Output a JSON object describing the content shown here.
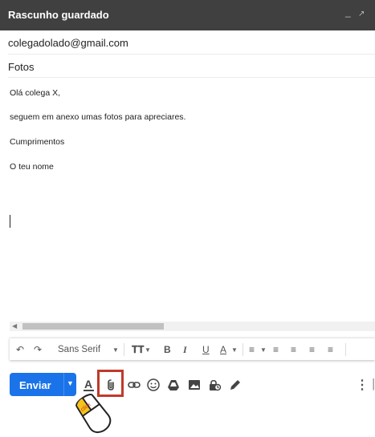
{
  "header": {
    "title": "Rascunho guardado"
  },
  "fields": {
    "to": "colegadolado@gmail.com",
    "subject": "Fotos"
  },
  "body": {
    "lines": [
      "Olá colega X,",
      "seguem em anexo umas fotos para apreciares.",
      "Cumprimentos",
      "O teu nome"
    ]
  },
  "formatting": {
    "font": "Sans Serif"
  },
  "actions": {
    "send_label": "Enviar"
  },
  "pointer": {
    "label": "click"
  }
}
